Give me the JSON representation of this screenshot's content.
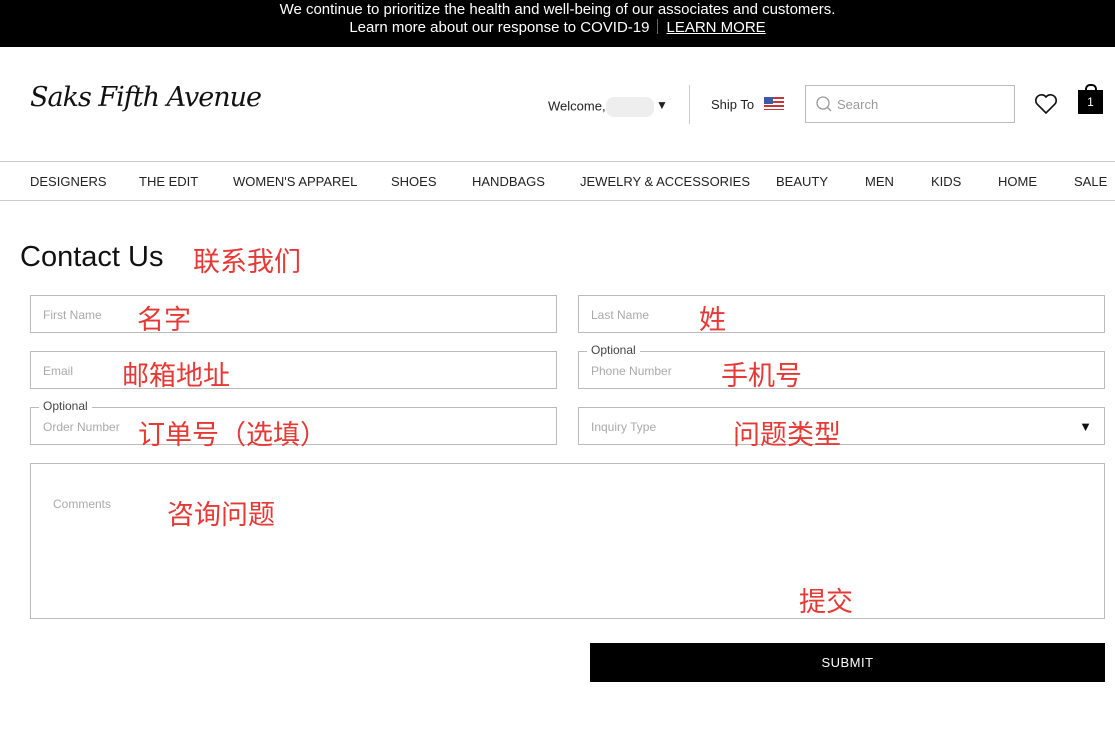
{
  "banner": {
    "line1": "We continue to prioritize the health and well-being of our associates and customers.",
    "line2": "Learn more about our response to COVID-19",
    "link": "LEARN MORE"
  },
  "header": {
    "logo": "Saks Fifth Avenue",
    "welcome": "Welcome,",
    "ship_to": "Ship To",
    "search_placeholder": "Search",
    "bag_count": "1"
  },
  "nav": [
    "DESIGNERS",
    "THE EDIT",
    "WOMEN'S APPAREL",
    "SHOES",
    "HANDBAGS",
    "JEWELRY & ACCESSORIES",
    "BEAUTY",
    "MEN",
    "KIDS",
    "HOME",
    "SALE"
  ],
  "page": {
    "title": "Contact Us",
    "title_note": "联系我们"
  },
  "form": {
    "first_name": {
      "placeholder": "First Name",
      "note": "名字"
    },
    "last_name": {
      "placeholder": "Last Name",
      "note": "姓"
    },
    "email": {
      "placeholder": "Email",
      "note": "邮箱地址"
    },
    "phone": {
      "label": "Optional",
      "placeholder": "Phone Number",
      "note": "手机号"
    },
    "order": {
      "label": "Optional",
      "placeholder": "Order Number",
      "note": "订单号（选填）"
    },
    "inquiry": {
      "placeholder": "Inquiry Type",
      "note": "问题类型"
    },
    "comments": {
      "placeholder": "Comments",
      "note": "咨询问题"
    },
    "submit_note": "提交",
    "submit": "SUBMIT"
  },
  "colors": {
    "annotation": "#e53935"
  }
}
